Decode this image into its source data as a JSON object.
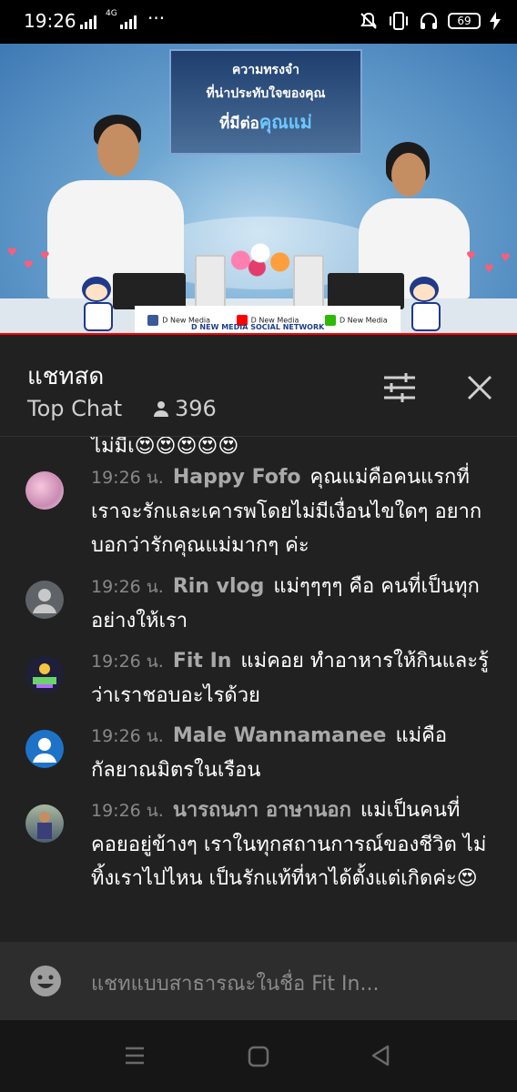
{
  "status_bar": {
    "time": "19:26",
    "network": "4G",
    "overflow": "···",
    "battery": "69",
    "icons": [
      "signal-icon",
      "mute-icon",
      "vibrate-icon",
      "headset-icon",
      "battery-icon",
      "charging-icon"
    ]
  },
  "video": {
    "title_line1": "ความทรงจำ",
    "title_line2": "ที่น่าประทับใจของคุณ",
    "title_line3_prefix": "ที่มีต่อ",
    "title_line3_highlight": "คุณแม่",
    "social": [
      {
        "icon": "facebook-icon",
        "label": "D New Media",
        "color": "#3b5998"
      },
      {
        "icon": "youtube-icon",
        "label": "D New Media",
        "color": "#ff0000"
      },
      {
        "icon": "line-icon",
        "label": "D New Media",
        "color": "#2dba00"
      }
    ],
    "network_label": "D NEW MEDIA SOCIAL NETWORK"
  },
  "chat_header": {
    "title": "แชทสด",
    "mode": "Top Chat",
    "viewer_count": "396"
  },
  "messages": [
    {
      "time": "19:26 น.",
      "author": "Happy Fofo",
      "text": "คุณแม่คือคนแรกที่เราจะรักและเคารพโดยไม่มีเงื่อนไขใดๆ อยากบอกว่ารักคุณแม่มากๆ ค่ะ",
      "avatar": "flower"
    },
    {
      "time": "19:26 น.",
      "author": "Rin vlog",
      "text": "แม่ๆๆๆๆ คือ คนที่เป็นทุกอย่างให้เรา",
      "avatar": "default-gray"
    },
    {
      "time": "19:26 น.",
      "author": "Fit In",
      "text": "แม่คอย ทำอาหารให้กินและรู้ว่าเราชอบอะไรด้วย",
      "avatar": "logo"
    },
    {
      "time": "19:26 น.",
      "author": "Male Wannamanee",
      "text": "แม่คือกัลยาณมิตรในเรือน",
      "avatar": "default-blue"
    },
    {
      "time": "19:26 น.",
      "author": "นารถนภา อาษานอก",
      "text": "แม่เป็นคนที่คอยอยู่ข้างๆ เราในทุกสถานการณ์ของชีวิต ไม่ทิ้งเราไปไหน เป็นรักแท้ที่หาได้ตั้งแต่เกิดค่ะ😍",
      "avatar": "photo"
    }
  ],
  "clipped_line": "ไม่มีเ😍😍😍😍😍",
  "input": {
    "placeholder": "แชทแบบสาธารณะในชื่อ Fit In..."
  },
  "colors": {
    "background": "#212121",
    "author": "#a9a9a9",
    "time": "#888888",
    "live_red": "#ff0000"
  }
}
